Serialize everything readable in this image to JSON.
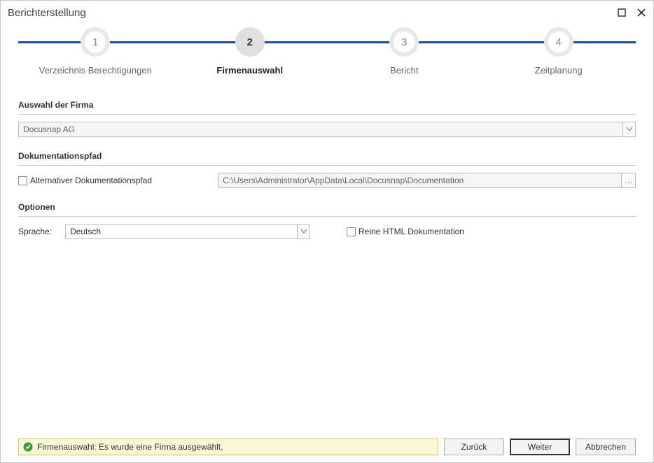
{
  "window": {
    "title": "Berichterstellung"
  },
  "steps": [
    {
      "num": "1",
      "label": "Verzeichnis Berechtigungen"
    },
    {
      "num": "2",
      "label": "Firmenauswahl"
    },
    {
      "num": "3",
      "label": "Bericht"
    },
    {
      "num": "4",
      "label": "Zeitplanung"
    }
  ],
  "sections": {
    "firma_header": "Auswahl der Firma",
    "firma_value": "Docusnap AG",
    "doku_header": "Dokumentationspfad",
    "alt_path_label": "Alternativer Dokumentationspfad",
    "path_value": "C:\\Users\\Administrator\\AppData\\Local\\Docusnap\\Documentation",
    "opt_header": "Optionen",
    "lang_label": "Sprache:",
    "lang_value": "Deutsch",
    "html_only_label": "Reine HTML Dokumentation"
  },
  "status": {
    "text": "Firmenauswahl: Es wurde eine Firma ausgewählt."
  },
  "buttons": {
    "back": "Zurück",
    "next": "Weiter",
    "cancel": "Abbrechen"
  },
  "browse_glyph": "…"
}
